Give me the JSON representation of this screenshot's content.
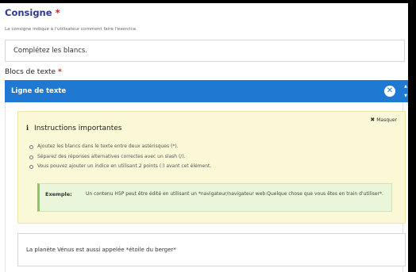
{
  "consigne": {
    "label": "Consigne",
    "required_marker": "*",
    "description": "La consigne indique à l'utilisateur comment faire l'exercice.",
    "value": "Complétez les blancs."
  },
  "blocs": {
    "label": "Blocs de texte",
    "required_marker": "*"
  },
  "list_item": {
    "title": "Ligne de texte",
    "remove_icon": "close-circle-icon",
    "order_icons": [
      "chevron-up-icon",
      "chevron-down-icon"
    ]
  },
  "instructions": {
    "hide_icon": "x-icon",
    "hide_label": "Masquer",
    "info_icon": "info-icon",
    "title": "Instructions importantes",
    "bullets": [
      "Ajoutez les blancs dans le texte entre deux astérisques (*).",
      "Séparez des réponses alternatives correctes avec un slash (/).",
      "Vous pouvez ajouter un indice en utilisant 2 points (:) avant cet élément."
    ],
    "example_label": "Exemple:",
    "example_text": "Un contenu H5P peut être édité en utilisant un *navigateur/navigateur web:Quelque chose que vous êtes en train d'utiliser*."
  },
  "text_value": "La planète Vénus est aussi appelée *étoile du berger*",
  "colors": {
    "header_bar": "#1f78d1",
    "label_blue": "#2c3a8c",
    "required": "#d21f1f",
    "instructions_bg": "#fbf8d8",
    "example_bg": "#eaf6d9"
  }
}
